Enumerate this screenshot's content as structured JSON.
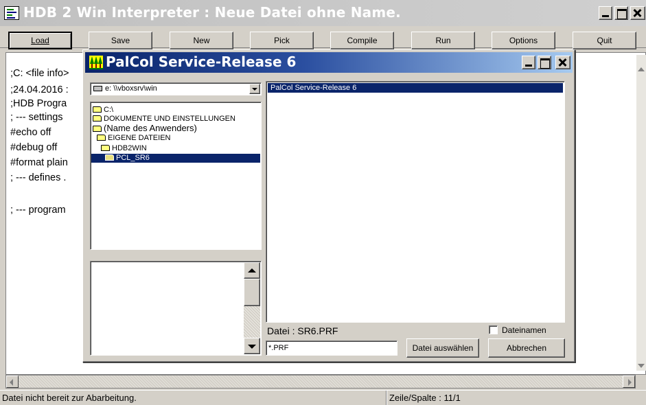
{
  "main_window": {
    "title": "HDB 2 Win Interpreter : Neue Datei ohne Name."
  },
  "toolbar": {
    "buttons": [
      {
        "label": "Load",
        "key": "L"
      },
      {
        "label": "Save",
        "key": "S"
      },
      {
        "label": "New",
        "key": "N"
      },
      {
        "label": "Pick",
        "key": "P"
      },
      {
        "label": "Compile",
        "key": "C"
      },
      {
        "label": "Run",
        "key": "R"
      },
      {
        "label": "Options",
        "key": "O"
      },
      {
        "label": "Quit",
        "key": "Q"
      }
    ]
  },
  "editor": {
    "lines": [
      ";C: <file info>",
      ";24.04.2016 :",
      ";HDB Progra",
      "; --- settings",
      "#echo off",
      "#debug off",
      "#format plain",
      "; --- defines .",
      "",
      "; --- program"
    ]
  },
  "status": {
    "message": "Datei nicht bereit zur Abarbeitung.",
    "position": "Zeile/Spalte : 11/1"
  },
  "dialog": {
    "title": "PalCol Service-Release 6",
    "drive": "e: \\\\vboxsrv\\win",
    "folders": [
      {
        "name": "C:\\",
        "level": 0
      },
      {
        "name": "DOKUMENTE UND EINSTELLUNGEN",
        "level": 0
      },
      {
        "name": "(Name des Anwenders)",
        "level": 0
      },
      {
        "name": "EIGENE DATEIEN",
        "level": 1
      },
      {
        "name": "HDB2WIN",
        "level": 2
      },
      {
        "name": "PCL_SR6",
        "level": 3,
        "selected": true
      }
    ],
    "files": [
      "PalCol Service-Release 6"
    ],
    "file_label": "Datei : SR6.PRF",
    "filter": "*.PRF",
    "checkbox_label": "Dateinamen",
    "checkbox_checked": false,
    "select_button": "Datei auswählen",
    "cancel_button": "Abbrechen"
  }
}
